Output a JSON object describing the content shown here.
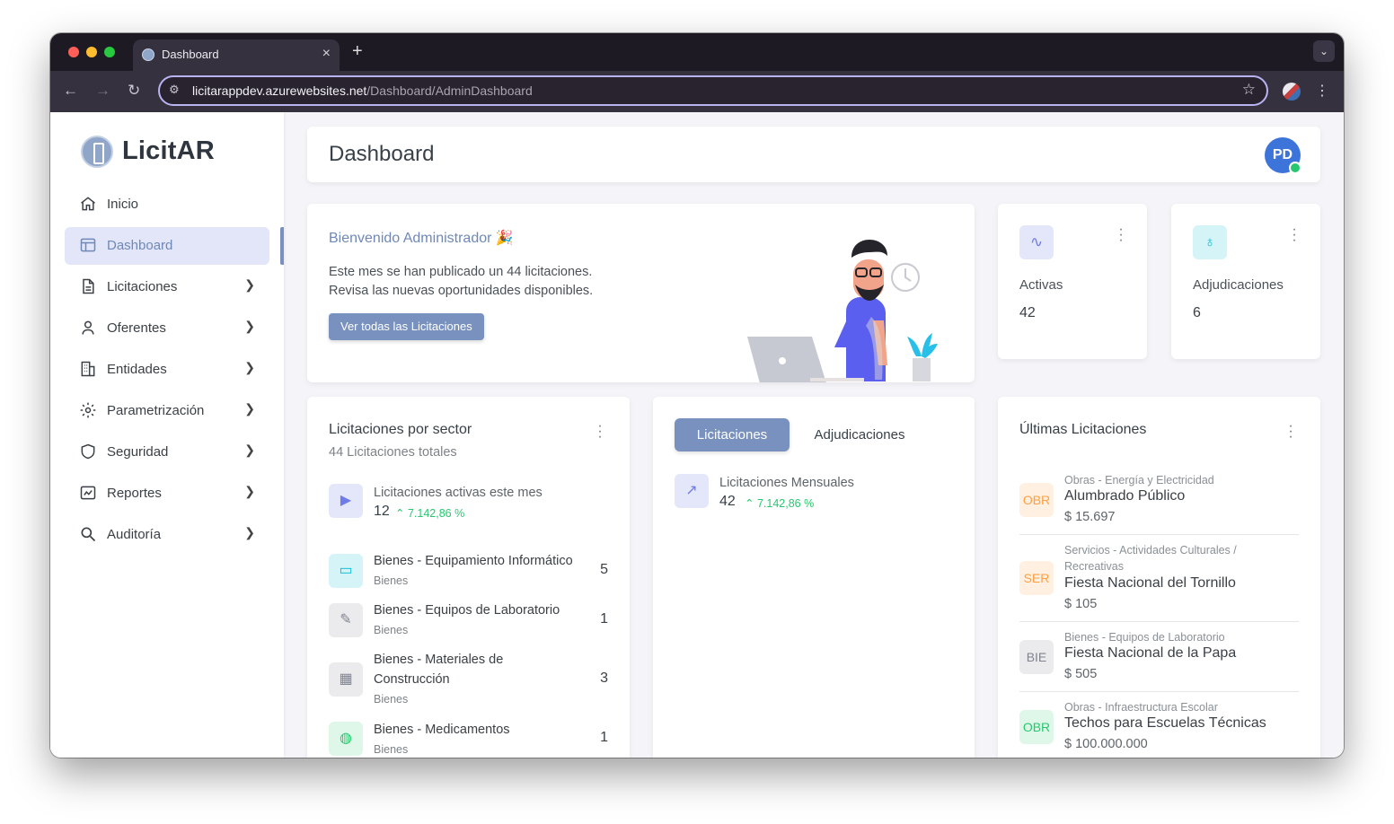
{
  "browser": {
    "tab_title": "Dashboard",
    "close": "×",
    "new_tab": "+",
    "url_domain": "licitarappdev.azurewebsites.net",
    "url_path": "/Dashboard/AdminDashboard"
  },
  "sidebar": {
    "brand": "LicitAR",
    "items": [
      {
        "label": "Inicio",
        "icon": "home-icon",
        "chevron": false
      },
      {
        "label": "Dashboard",
        "icon": "layout-icon",
        "chevron": false,
        "active": true
      },
      {
        "label": "Licitaciones",
        "icon": "file-text-icon",
        "chevron": true
      },
      {
        "label": "Oferentes",
        "icon": "user-icon",
        "chevron": true
      },
      {
        "label": "Entidades",
        "icon": "building-icon",
        "chevron": true
      },
      {
        "label": "Parametrización",
        "icon": "gear-icon",
        "chevron": true
      },
      {
        "label": "Seguridad",
        "icon": "shield-icon",
        "chevron": true
      },
      {
        "label": "Reportes",
        "icon": "chart-line-icon",
        "chevron": true
      },
      {
        "label": "Auditoría",
        "icon": "search-icon",
        "chevron": true
      }
    ]
  },
  "header": {
    "title": "Dashboard",
    "avatar_initials": "PD"
  },
  "welcome": {
    "heading": "Bienvenido Administrador",
    "emoji": "🎉",
    "line1": "Este mes se han publicado un 44 licitaciones.",
    "line2": "Revisa las nuevas oportunidades disponibles.",
    "button": "Ver todas las Licitaciones"
  },
  "stats": {
    "activas": {
      "label": "Activas",
      "value": "42",
      "icon": "pulse-icon"
    },
    "adjudicaciones": {
      "label": "Adjudicaciones",
      "value": "6",
      "icon": "award-icon"
    }
  },
  "sector": {
    "title": "Licitaciones por sector",
    "subtitle": "44 Licitaciones totales",
    "active_label": "Licitaciones activas este mes",
    "active_value": "12",
    "active_change": "7.142,86 %",
    "rows": [
      {
        "title_l1": "Bienes - Equipamiento Informático",
        "title_l2": "",
        "sub": "Bienes",
        "count": "5",
        "icon": "laptop-icon"
      },
      {
        "title_l1": "Bienes - Equipos de Laboratorio",
        "title_l2": "",
        "sub": "Bienes",
        "count": "1",
        "icon": "pipette-icon"
      },
      {
        "title_l1": "Bienes - Materiales de",
        "title_l2": "Construcción",
        "sub": "Bienes",
        "count": "3",
        "icon": "building-icon"
      },
      {
        "title_l1": "Bienes - Medicamentos",
        "title_l2": "",
        "sub": "Bienes",
        "count": "1",
        "icon": "pill-icon"
      }
    ]
  },
  "tabs": {
    "licitaciones": "Licitaciones",
    "adjudicaciones": "Adjudicaciones",
    "metric_label": "Licitaciones Mensuales",
    "metric_value": "42",
    "metric_change": "7.142,86 %"
  },
  "ultimas": {
    "title": "Últimas Licitaciones",
    "items": [
      {
        "badge": "OBR",
        "category": "Obras - Energía y Electricidad",
        "title": "Alumbrado Público",
        "price": "$ 15.697"
      },
      {
        "badge": "SER",
        "category": "Servicios - Actividades Culturales / Recreativas",
        "title": "Fiesta Nacional del Tornillo",
        "price": "$ 105"
      },
      {
        "badge": "BIE",
        "category": "Bienes - Equipos de Laboratorio",
        "title": "Fiesta Nacional de la Papa",
        "price": "$ 505"
      },
      {
        "badge": "OBR",
        "category": "Obras - Infraestructura Escolar",
        "title": "Techos para Escuelas Técnicas",
        "price": "$ 100.000.000"
      }
    ]
  },
  "colors": {
    "accent": "#7891bf",
    "success": "#28c76f",
    "warning": "#ff9f43",
    "info": "#00cfe8"
  }
}
